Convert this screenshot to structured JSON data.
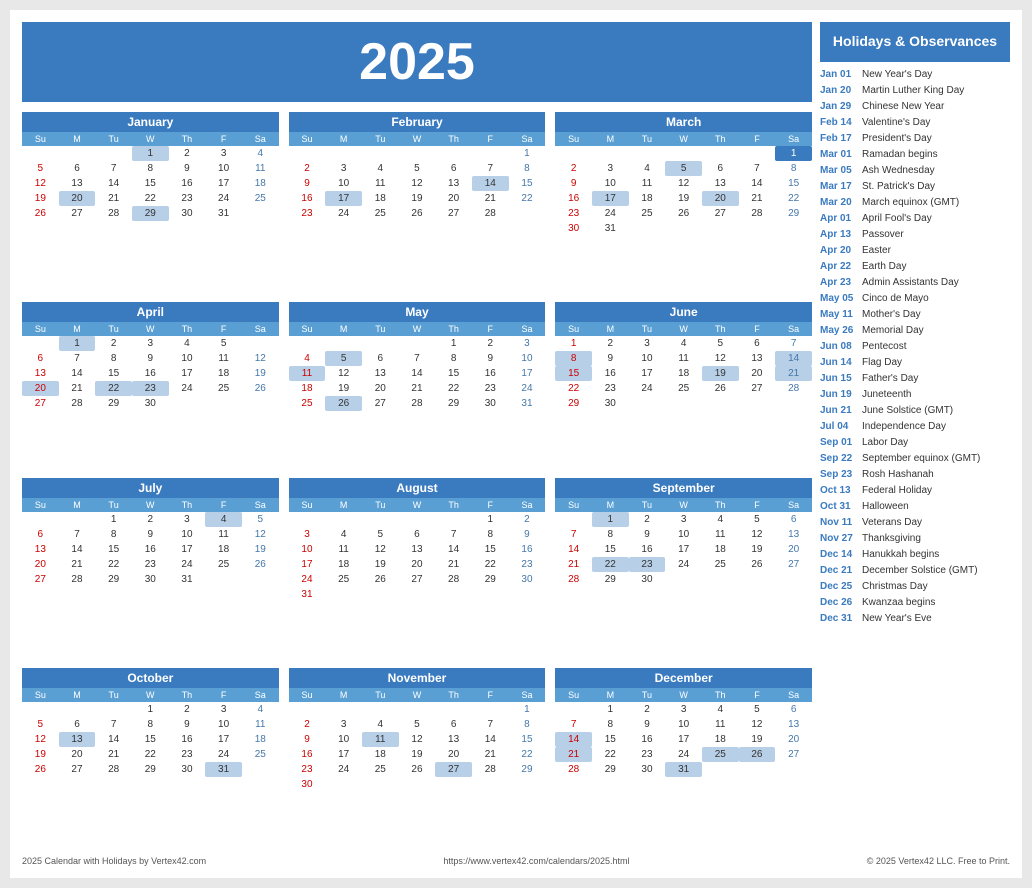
{
  "year": "2025",
  "header": {
    "title": "2025"
  },
  "sidebar": {
    "heading": "Holidays & Observances",
    "holidays": [
      {
        "date": "Jan 01",
        "name": "New Year's Day"
      },
      {
        "date": "Jan 20",
        "name": "Martin Luther King Day"
      },
      {
        "date": "Jan 29",
        "name": "Chinese New Year"
      },
      {
        "date": "Feb 14",
        "name": "Valentine's Day"
      },
      {
        "date": "Feb 17",
        "name": "President's Day"
      },
      {
        "date": "Mar 01",
        "name": "Ramadan begins"
      },
      {
        "date": "Mar 05",
        "name": "Ash Wednesday"
      },
      {
        "date": "Mar 17",
        "name": "St. Patrick's Day"
      },
      {
        "date": "Mar 20",
        "name": "March equinox (GMT)"
      },
      {
        "date": "Apr 01",
        "name": "April Fool's Day"
      },
      {
        "date": "Apr 13",
        "name": "Passover"
      },
      {
        "date": "Apr 20",
        "name": "Easter"
      },
      {
        "date": "Apr 22",
        "name": "Earth Day"
      },
      {
        "date": "Apr 23",
        "name": "Admin Assistants Day"
      },
      {
        "date": "May 05",
        "name": "Cinco de Mayo"
      },
      {
        "date": "May 11",
        "name": "Mother's Day"
      },
      {
        "date": "May 26",
        "name": "Memorial Day"
      },
      {
        "date": "Jun 08",
        "name": "Pentecost"
      },
      {
        "date": "Jun 14",
        "name": "Flag Day"
      },
      {
        "date": "Jun 15",
        "name": "Father's Day"
      },
      {
        "date": "Jun 19",
        "name": "Juneteenth"
      },
      {
        "date": "Jun 21",
        "name": "June Solstice (GMT)"
      },
      {
        "date": "Jul 04",
        "name": "Independence Day"
      },
      {
        "date": "Sep 01",
        "name": "Labor Day"
      },
      {
        "date": "Sep 22",
        "name": "September equinox (GMT)"
      },
      {
        "date": "Sep 23",
        "name": "Rosh Hashanah"
      },
      {
        "date": "Oct 13",
        "name": "Federal Holiday"
      },
      {
        "date": "Oct 31",
        "name": "Halloween"
      },
      {
        "date": "Nov 11",
        "name": "Veterans Day"
      },
      {
        "date": "Nov 27",
        "name": "Thanksgiving"
      },
      {
        "date": "Dec 14",
        "name": "Hanukkah begins"
      },
      {
        "date": "Dec 21",
        "name": "December Solstice (GMT)"
      },
      {
        "date": "Dec 25",
        "name": "Christmas Day"
      },
      {
        "date": "Dec 26",
        "name": "Kwanzaa begins"
      },
      {
        "date": "Dec 31",
        "name": "New Year's Eve"
      }
    ]
  },
  "footer": {
    "left": "2025 Calendar with Holidays by Vertex42.com",
    "center": "https://www.vertex42.com/calendars/2025.html",
    "right": "© 2025 Vertex42 LLC. Free to Print."
  }
}
